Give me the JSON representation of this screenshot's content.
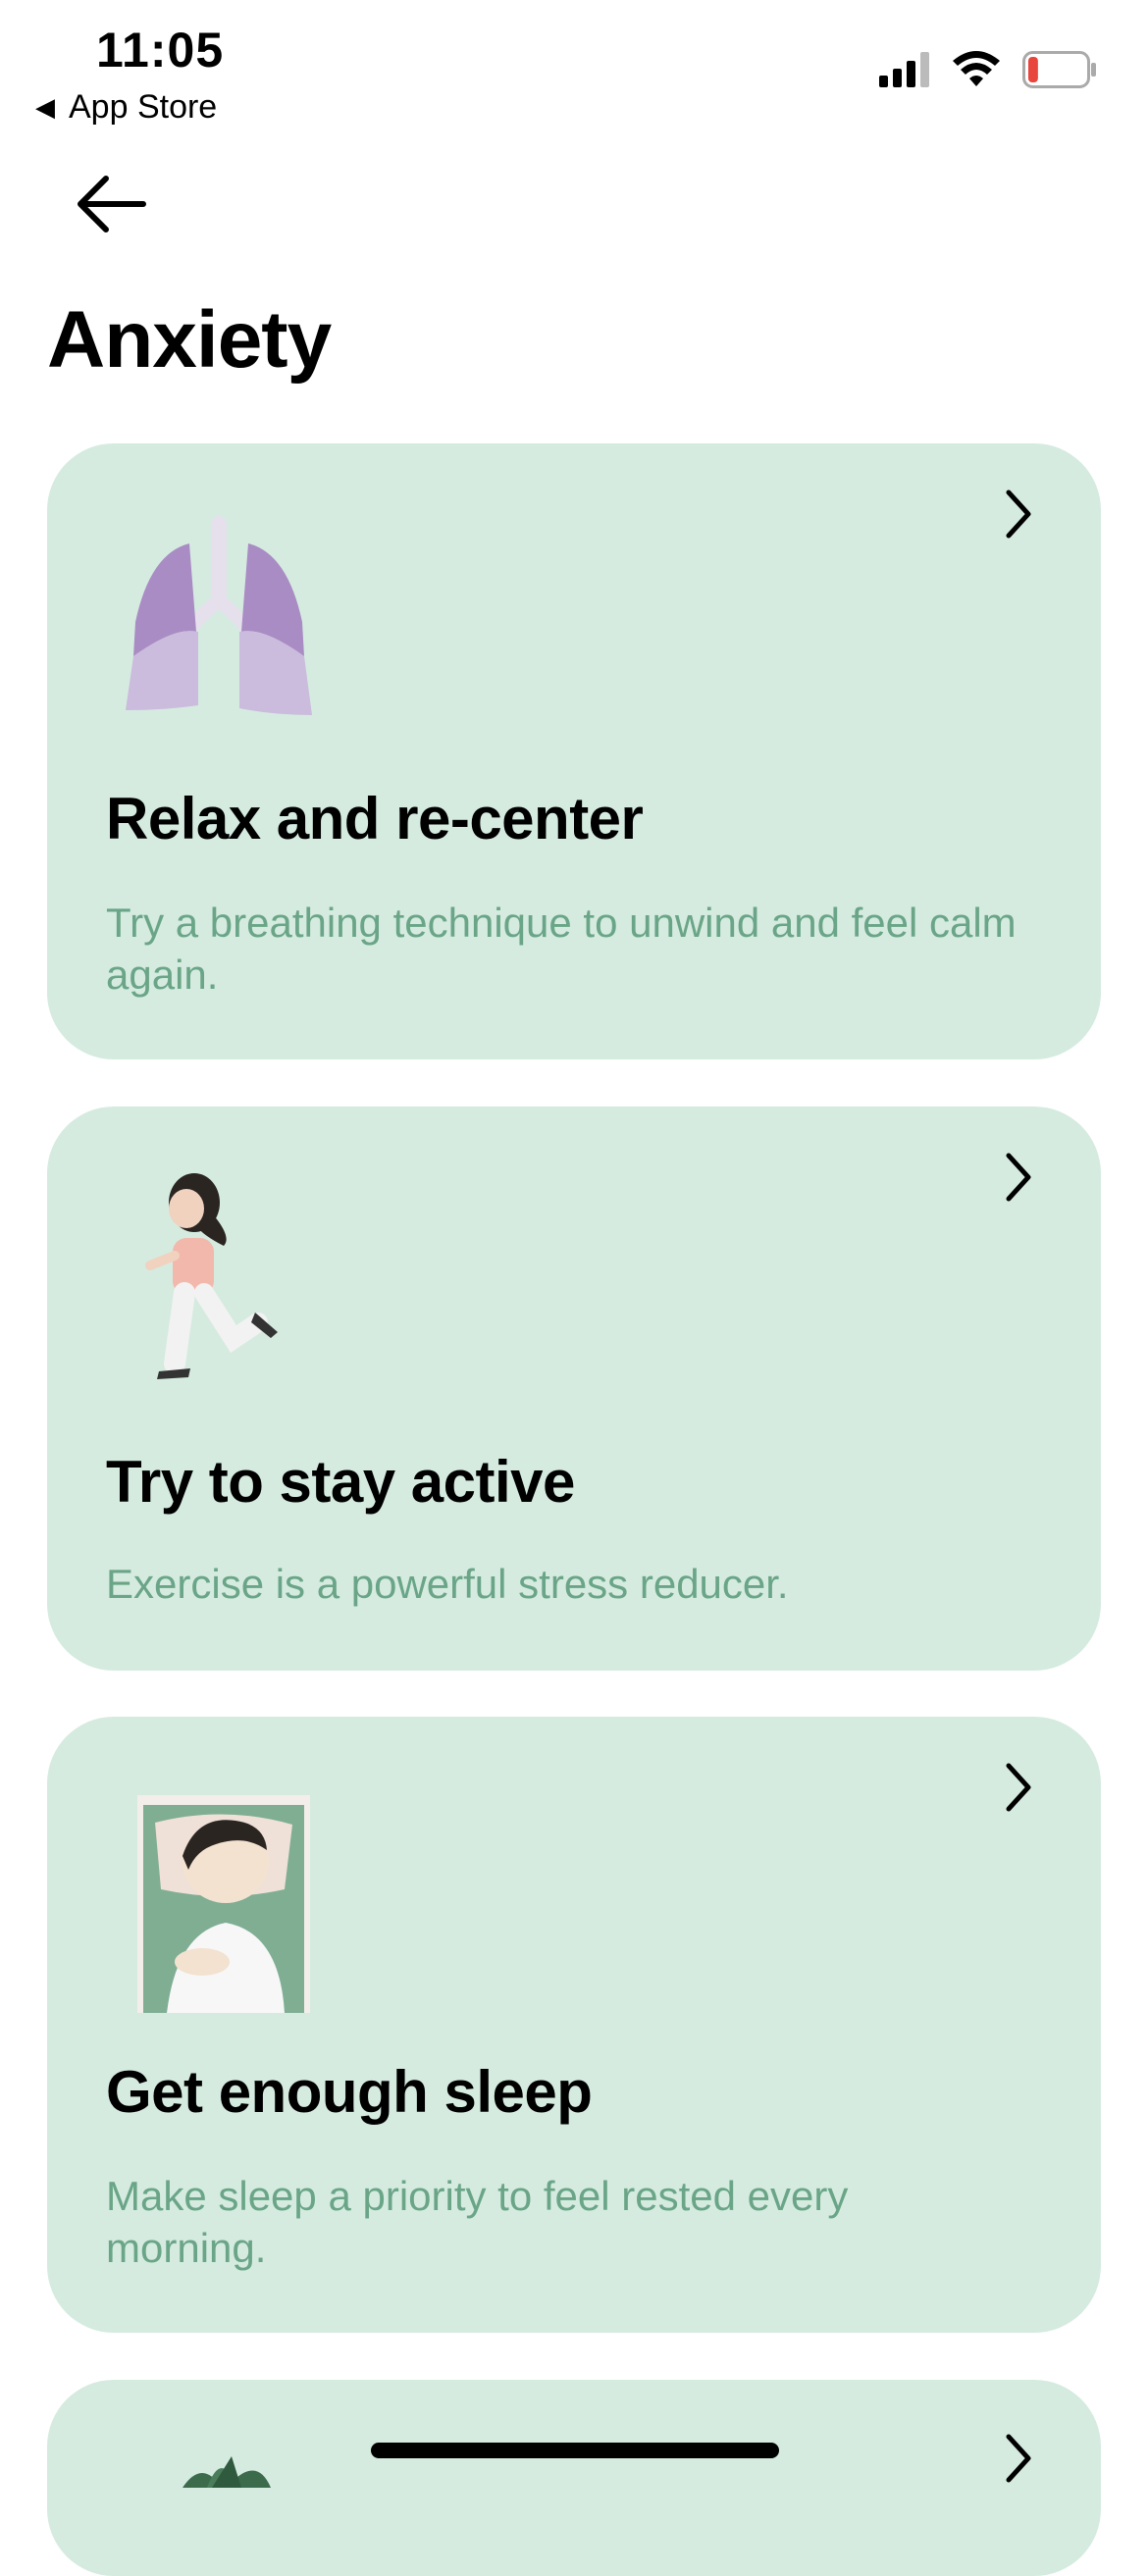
{
  "status_bar": {
    "time": "11:05",
    "back_app_label": "App Store",
    "battery_level": 0.1,
    "icons": [
      "signal-icon",
      "wifi-icon",
      "battery-icon"
    ]
  },
  "nav": {
    "back_icon": "arrow-left-icon"
  },
  "page": {
    "title": "Anxiety"
  },
  "cards": [
    {
      "title": "Relax and re-center",
      "description": "Try a breathing technique to unwind and feel calm again.",
      "illustration": "lungs-illustration"
    },
    {
      "title": "Try to stay active",
      "description": "Exercise is a powerful stress reducer.",
      "illustration": "running-person-illustration"
    },
    {
      "title": "Get enough sleep",
      "description": "Make sleep a priority to feel rested every morning.",
      "illustration": "sleeping-person-illustration"
    },
    {
      "illustration": "plant-illustration"
    }
  ],
  "colors": {
    "card_background": "#d5ebe0",
    "description_text": "#6aa587",
    "lung_purple": "#b59ccb",
    "battery_low": "#e8453c"
  }
}
